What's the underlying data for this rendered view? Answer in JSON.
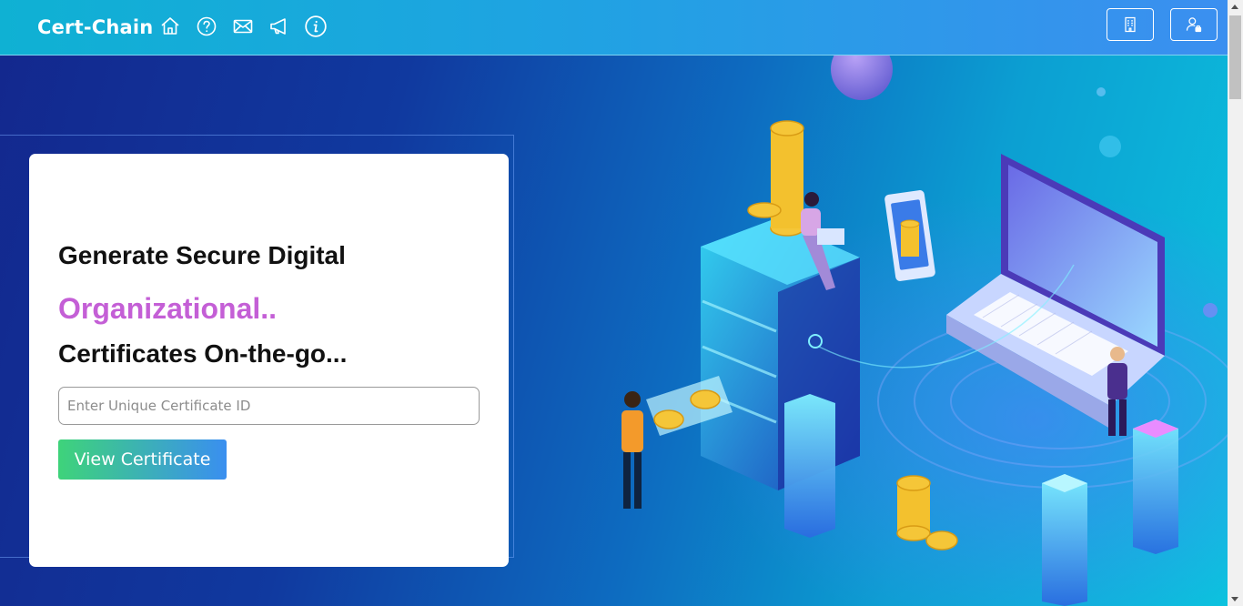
{
  "navbar": {
    "brand": "Cert-Chain",
    "icons": [
      "home-icon",
      "help-icon",
      "mail-icon",
      "announcement-icon",
      "info-icon"
    ],
    "buttons": [
      "organization-icon",
      "user-lock-icon"
    ]
  },
  "hero": {
    "line1": "Generate Secure Digital",
    "line2": "Organizational..",
    "line3": "Certificates On-the-go...",
    "input_placeholder": "Enter Unique Certificate ID",
    "input_value": "",
    "button_label": "View Certificate"
  },
  "colors": {
    "accent_text": "#c45fd6",
    "navbar_start": "#0fb1d3",
    "navbar_end": "#3b8ff0",
    "button_start": "#3ed37a",
    "button_end": "#3a8ff0"
  }
}
